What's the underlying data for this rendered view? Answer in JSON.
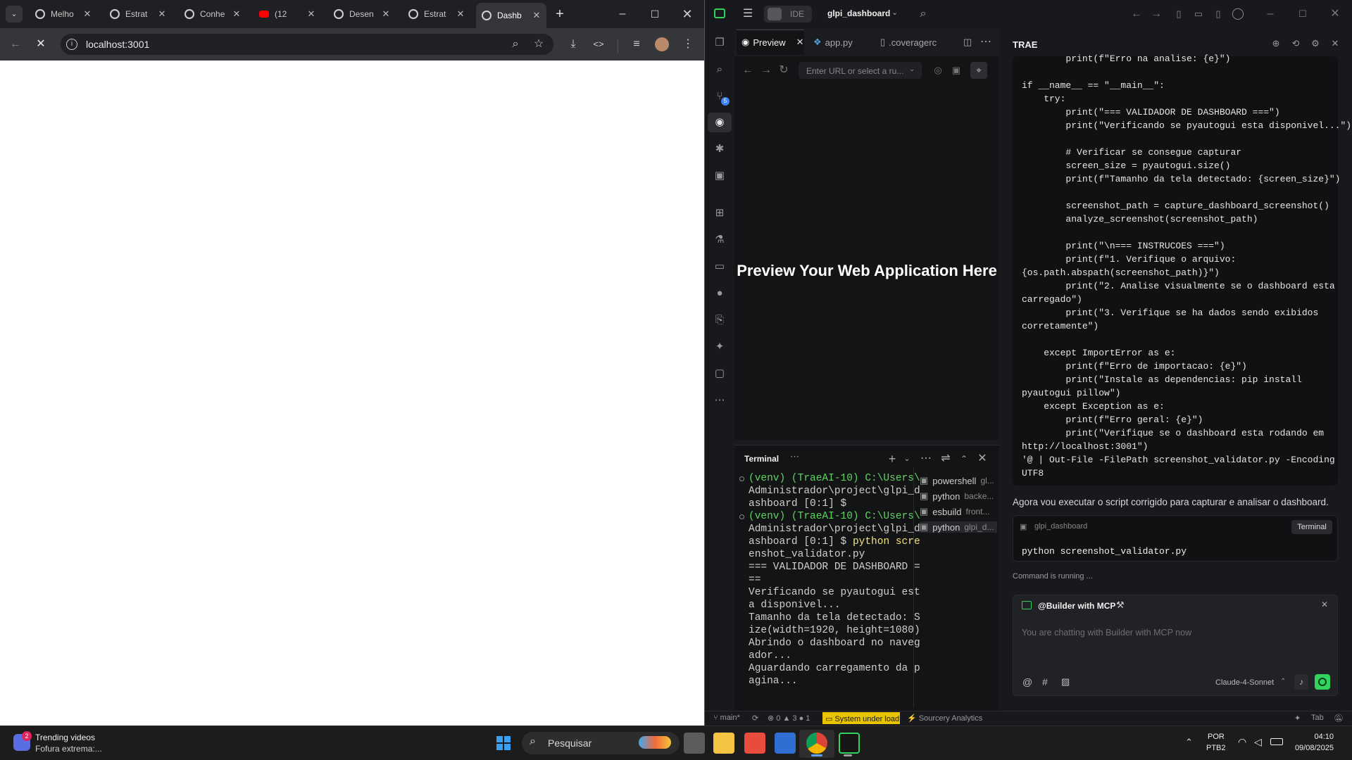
{
  "chrome": {
    "tabs": [
      {
        "title": "Melho",
        "icon": "chatgpt-icon"
      },
      {
        "title": "Estrat",
        "icon": "chatgpt-icon"
      },
      {
        "title": "Conhe",
        "icon": "chatgpt-icon"
      },
      {
        "title": "(12",
        "icon": "youtube-icon"
      },
      {
        "title": "Desen",
        "icon": "chatgpt-icon"
      },
      {
        "title": "Estrat",
        "icon": "chatgpt-icon"
      },
      {
        "title": "Dashb",
        "icon": "loading-icon"
      }
    ],
    "url": "localhost:3001"
  },
  "ide": {
    "mode_label": "IDE",
    "project": "glpi_dashboard",
    "editor_tabs": {
      "preview": "Preview",
      "app": "app.py",
      "coverage": ".coveragerc"
    },
    "url_placeholder": "Enter URL or select a ru...",
    "preview_message": "Preview Your Web Application Here",
    "terminal": {
      "title": "Terminal",
      "lines": [
        "(venv) (TraeAI-10) C:\\Users\\",
        "Administrador\\project\\glpi_d",
        "ashboard [0:1] $",
        "(venv) (TraeAI-10) C:\\Users\\",
        "Administrador\\project\\glpi_d",
        "ashboard [0:1] $ python scre",
        "enshot_validator.py",
        "=== VALIDADOR DE DASHBOARD =",
        "==",
        "Verificando se pyautogui est",
        "a disponivel...",
        "Tamanho da tela detectado: S",
        "ize(width=1920, height=1080)",
        "Abrindo o dashboard no naveg",
        "ador...",
        "Aguardando carregamento da p",
        "agina..."
      ],
      "sessions": [
        {
          "name": "powershell",
          "sub": "gl..."
        },
        {
          "name": "python",
          "sub": "backe..."
        },
        {
          "name": "esbuild",
          "sub": "front..."
        },
        {
          "name": "python",
          "sub": "glpi_d..."
        }
      ]
    },
    "chat": {
      "title": "TRAE",
      "code_lines": [
        "        print(f\"Erro na analise: {e}\")",
        "",
        "if __name__ == \"__main__\":",
        "    try:",
        "        print(\"=== VALIDADOR DE DASHBOARD ===\")",
        "        print(\"Verificando se pyautogui esta disponivel...\")",
        "",
        "        # Verificar se consegue capturar",
        "        screen_size = pyautogui.size()",
        "        print(f\"Tamanho da tela detectado: {screen_size}\")",
        "",
        "        screenshot_path = capture_dashboard_screenshot()",
        "        analyze_screenshot(screenshot_path)",
        "",
        "        print(\"\\n=== INSTRUCOES ===\")",
        "        print(f\"1. Verifique o arquivo:",
        "{os.path.abspath(screenshot_path)}\")",
        "        print(\"2. Analise visualmente se o dashboard esta",
        "carregado\")",
        "        print(\"3. Verifique se ha dados sendo exibidos",
        "corretamente\")",
        "",
        "    except ImportError as e:",
        "        print(f\"Erro de importacao: {e}\")",
        "        print(\"Instale as dependencias: pip install",
        "pyautogui pillow\")",
        "    except Exception as e:",
        "        print(f\"Erro geral: {e}\")",
        "        print(\"Verifique se o dashboard esta rodando em",
        "http://localhost:3001\")",
        "'@ | Out-File -FilePath screenshot_validator.py -Encoding",
        "UTF8"
      ],
      "message": "Agora vou executar o script corrigido para capturar e analisar o dashboard.",
      "command_card": {
        "project": "glpi_dashboard",
        "badge": "Terminal",
        "command": "python screenshot_validator.py"
      },
      "status": "Command is running ...",
      "agent": "@Builder with MCP",
      "input_placeholder": "You are chatting with Builder with MCP now",
      "model": "Claude-4-Sonnet"
    },
    "statusbar": {
      "branch": "main*",
      "errors": "0",
      "warnings": "3",
      "info": "1",
      "load": "System under load.",
      "plugin": "Sourcery Analytics",
      "tab": "Tab"
    }
  },
  "taskbar": {
    "widget_title": "Trending videos",
    "widget_sub": "Fofura extrema:...",
    "widget_badge": "2",
    "search": "Pesquisar",
    "lang1": "POR",
    "lang2": "PTB2",
    "time": "04:10",
    "date": "09/08/2025"
  },
  "colors": {
    "accent_green": "#32d25f",
    "load_yellow": "#e9c400",
    "youtube_red": "#ff0000"
  }
}
